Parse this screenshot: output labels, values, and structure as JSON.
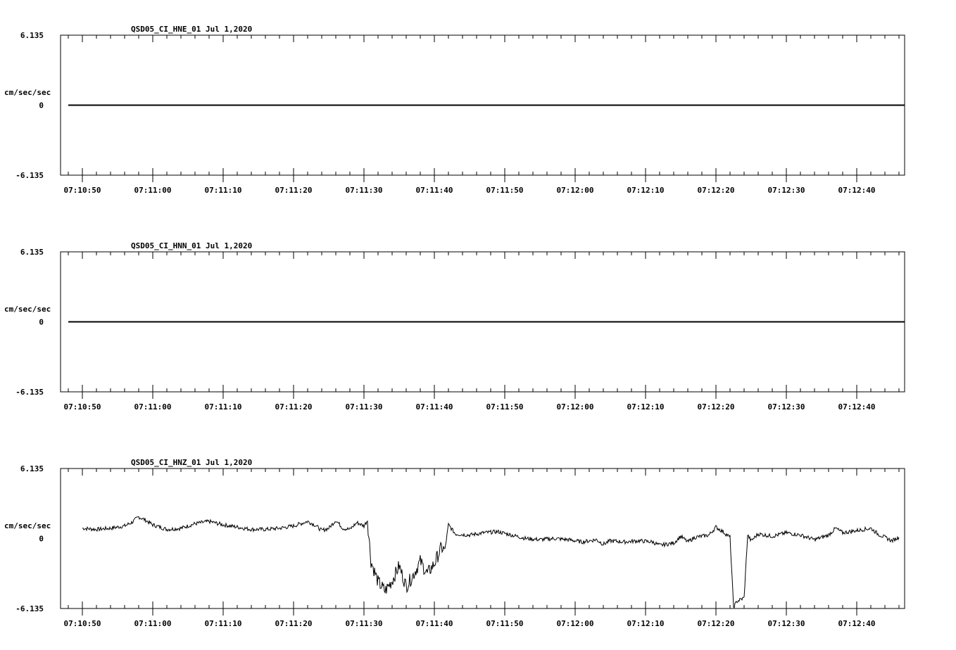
{
  "chart_data": [
    {
      "type": "line",
      "title": "QSD05_CI_HNE_01  Jul 1,2020",
      "ylabel": "cm/sec/sec",
      "y_ticks": [
        "6.135",
        "0",
        "-6.135"
      ],
      "ylim": [
        -6.135,
        6.135
      ],
      "x_ticks": [
        "07:10:50",
        "07:11:00",
        "07:11:10",
        "07:11:20",
        "07:11:30",
        "07:11:40",
        "07:11:50",
        "07:12:00",
        "07:12:10",
        "07:12:20",
        "07:12:30",
        "07:12:40"
      ],
      "x_range_seconds": [
        -3,
        116
      ],
      "series": [
        {
          "values": [
            [
              0,
              0
            ],
            [
              116,
              0
            ]
          ]
        }
      ]
    },
    {
      "type": "line",
      "title": "QSD05_CI_HNN_01  Jul 1,2020",
      "ylabel": "cm/sec/sec",
      "y_ticks": [
        "6.135",
        "0",
        "-6.135"
      ],
      "ylim": [
        -6.135,
        6.135
      ],
      "x_ticks": [
        "07:10:50",
        "07:11:00",
        "07:11:10",
        "07:11:20",
        "07:11:30",
        "07:11:40",
        "07:11:50",
        "07:12:00",
        "07:12:10",
        "07:12:20",
        "07:12:30",
        "07:12:40"
      ],
      "x_range_seconds": [
        -3,
        116
      ],
      "series": [
        {
          "values": [
            [
              0,
              0
            ],
            [
              116,
              0
            ]
          ]
        }
      ]
    },
    {
      "type": "line",
      "title": "QSD05_CI_HNZ_01  Jul 1,2020",
      "ylabel": "cm/sec/sec",
      "y_ticks": [
        "6.135",
        "0",
        "-6.135"
      ],
      "ylim": [
        -6.135,
        6.135
      ],
      "x_ticks": [
        "07:10:50",
        "07:11:00",
        "07:11:10",
        "07:11:20",
        "07:11:30",
        "07:11:40",
        "07:11:50",
        "07:12:00",
        "07:12:10",
        "07:12:20",
        "07:12:30",
        "07:12:40"
      ],
      "x_range_seconds": [
        -3,
        116
      ],
      "series": [
        {
          "values": [
            [
              0,
              0.9
            ],
            [
              2,
              0.8
            ],
            [
              4,
              0.9
            ],
            [
              6,
              1.1
            ],
            [
              7,
              1.4
            ],
            [
              8,
              1.9
            ],
            [
              9,
              1.6
            ],
            [
              10,
              1.2
            ],
            [
              12,
              0.8
            ],
            [
              14,
              0.9
            ],
            [
              16,
              1.3
            ],
            [
              18,
              1.5
            ],
            [
              20,
              1.2
            ],
            [
              22,
              1.0
            ],
            [
              24,
              0.8
            ],
            [
              26,
              0.8
            ],
            [
              28,
              0.9
            ],
            [
              30,
              1.1
            ],
            [
              32,
              1.5
            ],
            [
              33,
              1.2
            ],
            [
              34,
              0.7
            ],
            [
              35,
              0.9
            ],
            [
              36,
              1.6
            ],
            [
              37,
              0.9
            ],
            [
              38,
              0.8
            ],
            [
              39,
              1.4
            ],
            [
              40,
              1.1
            ],
            [
              40.5,
              1.6
            ],
            [
              41,
              -2.0
            ],
            [
              42,
              -3.8
            ],
            [
              43,
              -4.6
            ],
            [
              44,
              -3.7
            ],
            [
              45,
              -2.4
            ],
            [
              46,
              -4.2
            ],
            [
              47,
              -3.2
            ],
            [
              48,
              -2.0
            ],
            [
              49,
              -3.1
            ],
            [
              50,
              -2.2
            ],
            [
              51,
              -0.8
            ],
            [
              51.5,
              -1.0
            ],
            [
              52,
              1.2
            ],
            [
              53,
              0.4
            ],
            [
              55,
              0.3
            ],
            [
              57,
              0.5
            ],
            [
              59,
              0.6
            ],
            [
              61,
              0.3
            ],
            [
              63,
              0.0
            ],
            [
              65,
              -0.1
            ],
            [
              67,
              0.0
            ],
            [
              69,
              -0.1
            ],
            [
              71,
              -0.3
            ],
            [
              73,
              -0.1
            ],
            [
              74,
              -0.5
            ],
            [
              75,
              -0.2
            ],
            [
              77,
              -0.3
            ],
            [
              79,
              -0.2
            ],
            [
              81,
              -0.3
            ],
            [
              82,
              -0.6
            ],
            [
              84,
              -0.4
            ],
            [
              85,
              0.2
            ],
            [
              86,
              -0.3
            ],
            [
              87,
              0.1
            ],
            [
              89,
              0.3
            ],
            [
              90,
              1.0
            ],
            [
              91,
              0.6
            ],
            [
              92,
              0.1
            ],
            [
              92.5,
              -6.0
            ],
            [
              93,
              -5.5
            ],
            [
              94,
              -5.2
            ],
            [
              94.5,
              0.3
            ],
            [
              95,
              -0.2
            ],
            [
              96,
              0.4
            ],
            [
              98,
              0.2
            ],
            [
              100,
              0.5
            ],
            [
              102,
              0.3
            ],
            [
              103,
              0.1
            ],
            [
              104,
              -0.1
            ],
            [
              106,
              0.3
            ],
            [
              107,
              0.9
            ],
            [
              108,
              0.5
            ],
            [
              110,
              0.7
            ],
            [
              112,
              0.9
            ],
            [
              113,
              0.4
            ],
            [
              115,
              -0.2
            ],
            [
              116,
              0.1
            ]
          ]
        }
      ]
    }
  ]
}
